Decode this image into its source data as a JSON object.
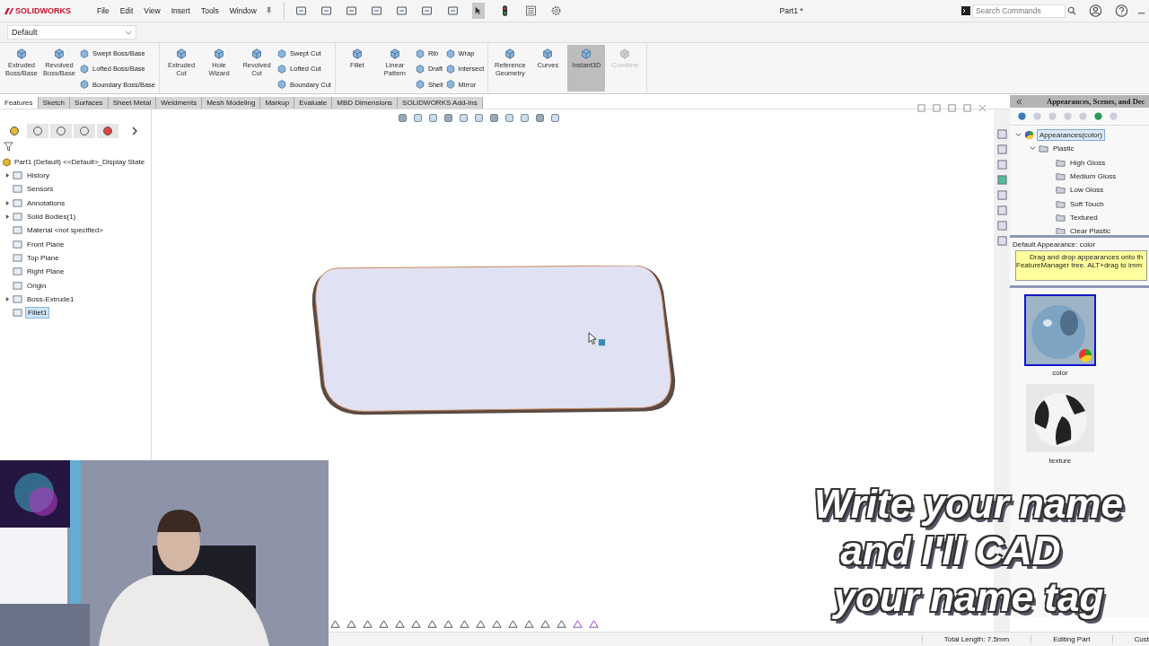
{
  "app": {
    "logo": "SOLIDWORKS"
  },
  "menu": [
    "File",
    "Edit",
    "View",
    "Insert",
    "Tools",
    "Window"
  ],
  "document_title": "Part1 *",
  "search": {
    "placeholder": "Search Commands"
  },
  "configuration": {
    "value": "Default"
  },
  "ribbon": {
    "groups": [
      {
        "items": [
          {
            "label": "Extruded Boss/Base",
            "kind": "big",
            "selected": false,
            "disabled": false
          },
          {
            "label": "Revolved Boss/Base",
            "kind": "big",
            "selected": false,
            "disabled": false
          },
          {
            "label": "Swept Boss/Base",
            "kind": "small",
            "selected": false,
            "disabled": false
          },
          {
            "label": "Lofted Boss/Base",
            "kind": "small",
            "selected": false,
            "disabled": false
          },
          {
            "label": "Boundary Boss/Base",
            "kind": "small",
            "selected": false,
            "disabled": false
          }
        ]
      },
      {
        "items": [
          {
            "label": "Extruded Cut",
            "kind": "big",
            "selected": false,
            "disabled": false
          },
          {
            "label": "Hole Wizard",
            "kind": "big",
            "selected": false,
            "disabled": false
          },
          {
            "label": "Revolved Cut",
            "kind": "big",
            "selected": false,
            "disabled": false
          },
          {
            "label": "Swept Cut",
            "kind": "small",
            "selected": false,
            "disabled": false
          },
          {
            "label": "Lofted Cut",
            "kind": "small",
            "selected": false,
            "disabled": false
          },
          {
            "label": "Boundary Cut",
            "kind": "small",
            "selected": false,
            "disabled": false
          }
        ]
      },
      {
        "items": [
          {
            "label": "Fillet",
            "kind": "big",
            "selected": false,
            "disabled": false
          },
          {
            "label": "Linear Pattern",
            "kind": "big",
            "selected": false,
            "disabled": false
          },
          {
            "label": "Rib",
            "kind": "small",
            "selected": false,
            "disabled": false
          },
          {
            "label": "Draft",
            "kind": "small",
            "selected": false,
            "disabled": false
          },
          {
            "label": "Shell",
            "kind": "small",
            "selected": false,
            "disabled": false
          },
          {
            "label": "Wrap",
            "kind": "small",
            "selected": false,
            "disabled": false
          },
          {
            "label": "Intersect",
            "kind": "small",
            "selected": false,
            "disabled": false
          },
          {
            "label": "Mirror",
            "kind": "small",
            "selected": false,
            "disabled": false
          }
        ]
      },
      {
        "items": [
          {
            "label": "Reference Geometry",
            "kind": "big",
            "selected": false,
            "disabled": false
          },
          {
            "label": "Curves",
            "kind": "big",
            "selected": false,
            "disabled": false
          },
          {
            "label": "Instant3D",
            "kind": "big",
            "selected": true,
            "disabled": false
          },
          {
            "label": "Combine",
            "kind": "big",
            "selected": false,
            "disabled": true
          }
        ]
      }
    ]
  },
  "tabs": [
    {
      "label": "Features",
      "selected": true
    },
    {
      "label": "Sketch",
      "selected": false
    },
    {
      "label": "Surfaces",
      "selected": false
    },
    {
      "label": "Sheet Metal",
      "selected": false
    },
    {
      "label": "Weldments",
      "selected": false
    },
    {
      "label": "Mesh Modeling",
      "selected": false
    },
    {
      "label": "Markup",
      "selected": false
    },
    {
      "label": "Evaluate",
      "selected": false
    },
    {
      "label": "MBD Dimensions",
      "selected": false
    },
    {
      "label": "SOLIDWORKS Add-Ins",
      "selected": false
    }
  ],
  "feature_manager": {
    "panel_tabs": [
      {
        "selected": true
      },
      {
        "selected": false
      },
      {
        "selected": false
      },
      {
        "selected": false
      },
      {
        "selected": false
      }
    ],
    "root": "Part1 (Default) <<Default>_Display State",
    "items": [
      {
        "label": "History",
        "has_children": true,
        "selected": false
      },
      {
        "label": "Sensors",
        "has_children": false,
        "selected": false
      },
      {
        "label": "Annotations",
        "has_children": true,
        "selected": false
      },
      {
        "label": "Solid Bodies(1)",
        "has_children": true,
        "selected": false
      },
      {
        "label": "Material <not specified>",
        "has_children": false,
        "selected": false
      },
      {
        "label": "Front Plane",
        "has_children": false,
        "selected": false
      },
      {
        "label": "Top Plane",
        "has_children": false,
        "selected": false
      },
      {
        "label": "Right Plane",
        "has_children": false,
        "selected": false
      },
      {
        "label": "Origin",
        "has_children": false,
        "selected": false
      },
      {
        "label": "Boss-Extrude1",
        "has_children": true,
        "selected": false
      },
      {
        "label": "Fillet1",
        "has_children": false,
        "selected": true
      }
    ]
  },
  "task_pane": {
    "title": "Appearances, Scenes, and Dec",
    "tree": [
      {
        "label": "Appearances(color)",
        "expanded": true,
        "selected": true,
        "children": [
          {
            "label": "Plastic",
            "expanded": true,
            "selected": false,
            "children": [
              {
                "label": "High Gloss",
                "selected": false
              },
              {
                "label": "Medium Gloss",
                "selected": false
              },
              {
                "label": "Low Gloss",
                "selected": false
              },
              {
                "label": "Soft Touch",
                "selected": false
              },
              {
                "label": "Textured",
                "selected": false
              },
              {
                "label": "Clear Plastic",
                "selected": false
              }
            ]
          }
        ]
      }
    ],
    "default_appearance": "Default Appearance: color",
    "hint": [
      "Drag and drop appearances onto th",
      "FeatureManager tree.  ALT+drag to imm"
    ],
    "thumbnails": [
      {
        "label": "color",
        "selected": true,
        "kind": "glossy"
      },
      {
        "label": "texture",
        "selected": false,
        "kind": "checker"
      }
    ]
  },
  "status_bar": [
    "Total Length: 7.5mm",
    "Editing Part",
    "Cust"
  ],
  "caption": [
    "Write your name",
    "and I'll CAD",
    "your name tag"
  ]
}
